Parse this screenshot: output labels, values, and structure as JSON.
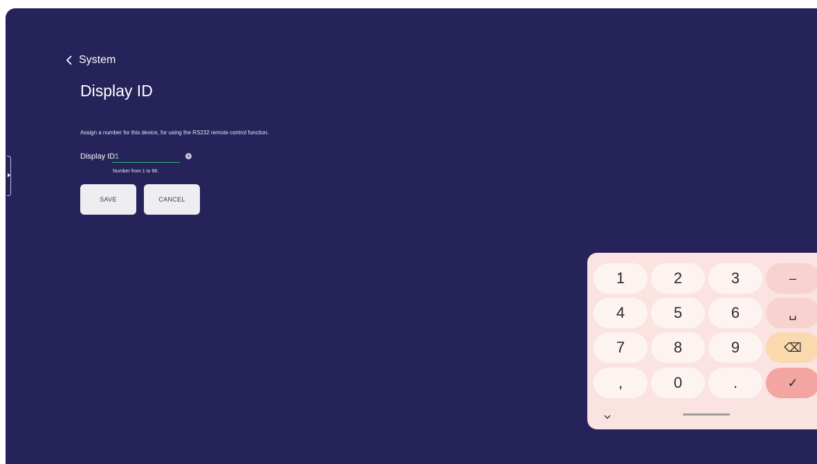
{
  "nav": {
    "back_label": "System"
  },
  "page": {
    "title": "Display ID",
    "description": "Assign a number for this device, for using the RS232 remote control function."
  },
  "field": {
    "label": "Display ID:",
    "value": "1",
    "hint": "Number from 1 to 98."
  },
  "buttons": {
    "save": "SAVE",
    "cancel": "CANCEL"
  },
  "keypad": {
    "keys": [
      "1",
      "2",
      "3",
      "–",
      "4",
      "5",
      "6",
      "␣",
      "7",
      "8",
      "9",
      "⌫",
      ",",
      "0",
      ".",
      "✓"
    ],
    "collapse_icon": "chevron-down-icon"
  },
  "colors": {
    "background": "#26235a",
    "accent_green": "#4fd48a",
    "keypad_bg": "#fae3e0",
    "confirm_key": "#f2a5a1",
    "delete_key": "#f9d9ad"
  }
}
